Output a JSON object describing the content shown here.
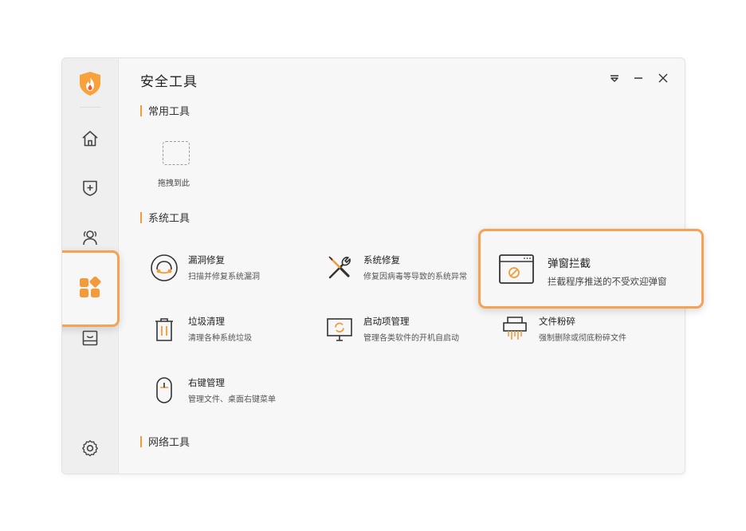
{
  "window": {
    "title": "安全工具",
    "controls": [
      "menu-icon",
      "minimize-icon",
      "close-icon"
    ]
  },
  "sidebar": {
    "logo": "shield-flame-logo",
    "items": [
      {
        "icon": "home-icon",
        "name": "home"
      },
      {
        "icon": "shield-plus-icon",
        "name": "protection"
      },
      {
        "icon": "users-icon",
        "name": "accounts"
      },
      {
        "icon": "apps-grid-icon",
        "name": "tools",
        "active": true
      },
      {
        "icon": "inbox-icon",
        "name": "box"
      },
      {
        "icon": "settings-icon",
        "name": "settings"
      }
    ]
  },
  "sections": {
    "common": {
      "heading": "常用工具",
      "drop_label": "拖拽到此"
    },
    "system": {
      "heading": "系统工具",
      "tools": [
        {
          "name": "漏洞修复",
          "desc": "扫描并修复系统漏洞",
          "icon": "vulnerability-icon"
        },
        {
          "name": "系统修复",
          "desc": "修复因病毒等导致的系统异常",
          "icon": "wrench-screwdriver-icon"
        },
        {
          "name": "弹窗拦截",
          "desc": "拦截程序推送的不受欢迎弹窗",
          "icon": "popup-block-icon",
          "highlighted": true
        },
        {
          "name": "垃圾清理",
          "desc": "清理各种系统垃圾",
          "icon": "trash-icon"
        },
        {
          "name": "启动项管理",
          "desc": "管理各类软件的开机自启动",
          "icon": "startup-monitor-icon"
        },
        {
          "name": "文件粉碎",
          "desc": "强制删除或彻底粉碎文件",
          "icon": "shredder-icon"
        },
        {
          "name": "右键管理",
          "desc": "管理文件、桌面右键菜单",
          "icon": "mouse-icon"
        }
      ]
    },
    "network": {
      "heading": "网络工具"
    }
  },
  "colors": {
    "accent": "#f39b3a",
    "highlight_border": "#f5a254",
    "window_bg": "#f7f7f7",
    "sidebar_bg": "#efefef"
  }
}
